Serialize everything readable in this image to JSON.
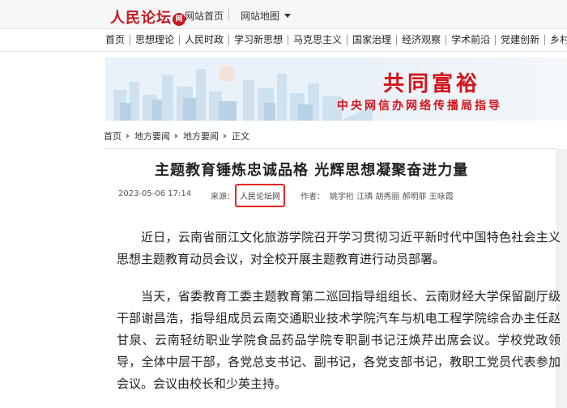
{
  "header": {
    "logo_text": "人民论坛",
    "logo_badge": "网",
    "home_link": "网站首页",
    "map_link": "网站地图"
  },
  "nav": {
    "items": [
      "首页",
      "思想理论",
      "人民时政",
      "学习新思想",
      "马克思主义",
      "国家治理",
      "经济观察",
      "学术前沿",
      "党建创新",
      "乡村振兴"
    ]
  },
  "banner": {
    "title": "共同富裕",
    "subtitle": "中央网信办网络传播局指导"
  },
  "breadcrumb": {
    "items": [
      "首页",
      "地方要闻",
      "地方要闻",
      "正文"
    ]
  },
  "article": {
    "title": "主题教育锤炼忠诚品格  光辉思想凝聚奋进力量",
    "date": "2023-05-06 17:14",
    "source_label": "来源：",
    "source": "人民论坛网",
    "author_label": "作者：",
    "authors": "姚宇桁 江璘 胡秀丽 郝明菲 王咏霞",
    "paragraphs": [
      "近日，云南省丽江文化旅游学院召开学习贯彻习近平新时代中国特色社会主义思想主题教育动员会议，对全校开展主题教育进行动员部署。",
      "当天，省委教育工委主题教育第二巡回指导组组长、云南财经大学保留副厅级干部谢昌浩，指导组成员云南交通职业技术学院汽车与机电工程学院综合办主任赵甘泉、云南轻纺职业学院食品药品学院专职副书记汪焕芹出席会议。学校党政领导，全体中层干部，各党总支书记、副书记，各党支部书记，教职工党员代表参加会议。会议由校长和少英主持。"
    ]
  },
  "colors": {
    "brand_red": "#c8161d",
    "highlight_box": "#e8231f"
  }
}
